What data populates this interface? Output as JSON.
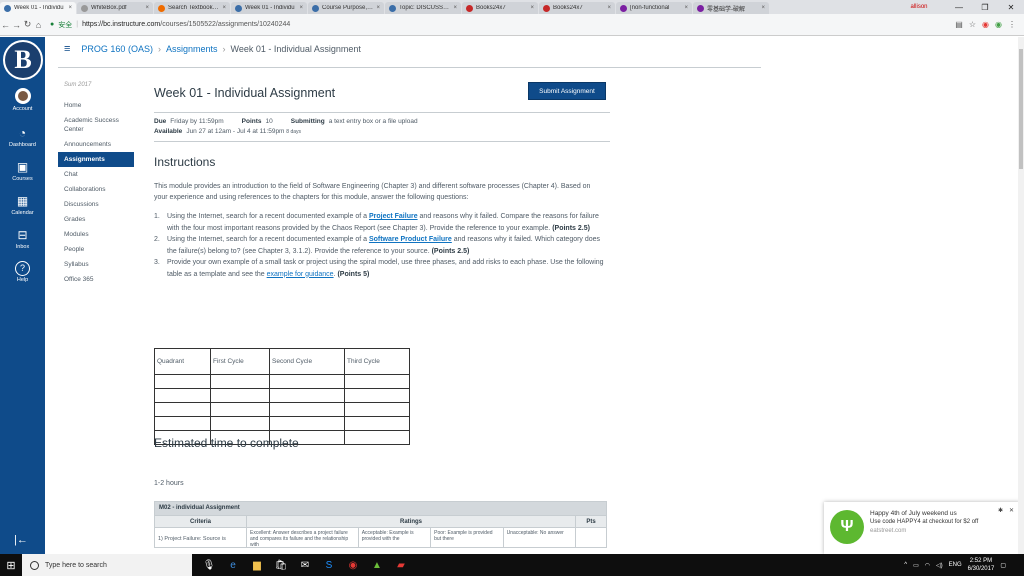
{
  "browser": {
    "tabs": [
      {
        "title": "Week 01 - Individu",
        "color": "#3b6ea8",
        "active": true
      },
      {
        "title": "WhiteBox.pdf",
        "color": "#999999",
        "active": false
      },
      {
        "title": "Search Textbook So",
        "color": "#ef6c00",
        "active": false
      },
      {
        "title": "Week 01 - Individu",
        "color": "#3b6ea8",
        "active": false
      },
      {
        "title": "Course Purpose, Te",
        "color": "#3b6ea8",
        "active": false
      },
      {
        "title": "Topic: DISCUSSION",
        "color": "#3b6ea8",
        "active": false
      },
      {
        "title": "Books24x7",
        "color": "#c62828",
        "active": false
      },
      {
        "title": "Books24x7",
        "color": "#c62828",
        "active": false
      },
      {
        "title": "[non-functional",
        "color": "#7b1fa2",
        "active": false
      },
      {
        "title": "零基础学-破解",
        "color": "#7b1fa2",
        "active": false
      }
    ],
    "profile": "allison",
    "url_prefix": "https://bc.instructure.com",
    "url_path": "/courses/1505522/assignments/10240244",
    "secure_label": "安全"
  },
  "global_nav": {
    "logo_letter": "B",
    "items": [
      {
        "label": "Account",
        "icon": "user-avatar"
      },
      {
        "label": "Dashboard",
        "icon": "speedometer-icon"
      },
      {
        "label": "Courses",
        "icon": "book-icon"
      },
      {
        "label": "Calendar",
        "icon": "calendar-icon"
      },
      {
        "label": "Inbox",
        "icon": "inbox-icon"
      },
      {
        "label": "Help",
        "icon": "help-icon"
      }
    ]
  },
  "breadcrumb": {
    "course": "PROG 160 (OAS)",
    "section": "Assignments",
    "current": "Week 01 - Individual Assignment"
  },
  "course_nav": {
    "term": "Sum 2017",
    "items": [
      "Home",
      "Academic Success Center",
      "Announcements",
      "Assignments",
      "Chat",
      "Collaborations",
      "Discussions",
      "Grades",
      "Modules",
      "People",
      "Syllabus",
      "Office 365"
    ],
    "active_index": 3
  },
  "assignment": {
    "title": "Week 01 - Individual Assignment",
    "submit_label": "Submit Assignment",
    "due_label": "Due",
    "due_value": "Friday by 11:59pm",
    "points_label": "Points",
    "points_value": "10",
    "submitting_label": "Submitting",
    "submitting_value": "a text entry box or a file upload",
    "available_label": "Available",
    "available_value": "Jun 27 at 12am - Jul 4 at 11:59pm",
    "available_days": "8 days",
    "instructions_heading": "Instructions",
    "intro": "This module provides an introduction to the field of Software Engineering (Chapter 3) and different software processes (Chapter 4). Based on your experience and using references to the chapters for this module, answer the following questions:",
    "q1_pre": "Using the Internet, search for a recent documented example of a ",
    "q1_link": "Project Failure",
    "q1_post": " and reasons why it failed. Compare the reasons for failure with the four most important reasons provided by the Chaos Report (see Chapter 3). Provide the reference to your example. ",
    "q1_points": "(Points 2.5)",
    "q2_pre": "Using the Internet, search for a recent documented example of a ",
    "q2_link": "Software Product Failure",
    "q2_post": " and reasons why it failed. Which category does the failure(s) belong to? (see Chapter 3, 3.1.2). Provide the reference to your source. ",
    "q2_points": "(Points 2.5)",
    "q3_pre": "Provide your own example of a small task or project using the spiral model, use three phases, and add risks to each phase. Use the following table as a template and see the ",
    "q3_link": "example for guidance",
    "q3_post": ". ",
    "q3_points": "(Points 5)",
    "table_headers": [
      "Quadrant",
      "First Cycle",
      "Second Cycle",
      "Third Cycle"
    ],
    "estimate_heading": "Estimated time to complete",
    "estimate_value": "1-2 hours"
  },
  "rubric": {
    "title": "M02 - individual Assignment",
    "col_criteria": "Criteria",
    "col_ratings": "Ratings",
    "col_pts": "Pts",
    "row1_criteria": "1) Project Failure: Source is",
    "ratings": [
      "Excellent: Answer describes a project failure and compares its failure and the relationship with",
      "Acceptable: Example is provided with the",
      "Poor: Example is provided but there",
      "Unacceptable: No answer"
    ]
  },
  "toast": {
    "title": "Happy 4th of July weekend us",
    "body": "Use code HAPPY4 at checkout for $2 off",
    "site": "eatstreet.com",
    "icon_letter": "Ψ"
  },
  "taskbar": {
    "search_placeholder": "Type here to search",
    "lang": "ENG",
    "time": "2:52 PM",
    "date": "6/30/2017"
  }
}
